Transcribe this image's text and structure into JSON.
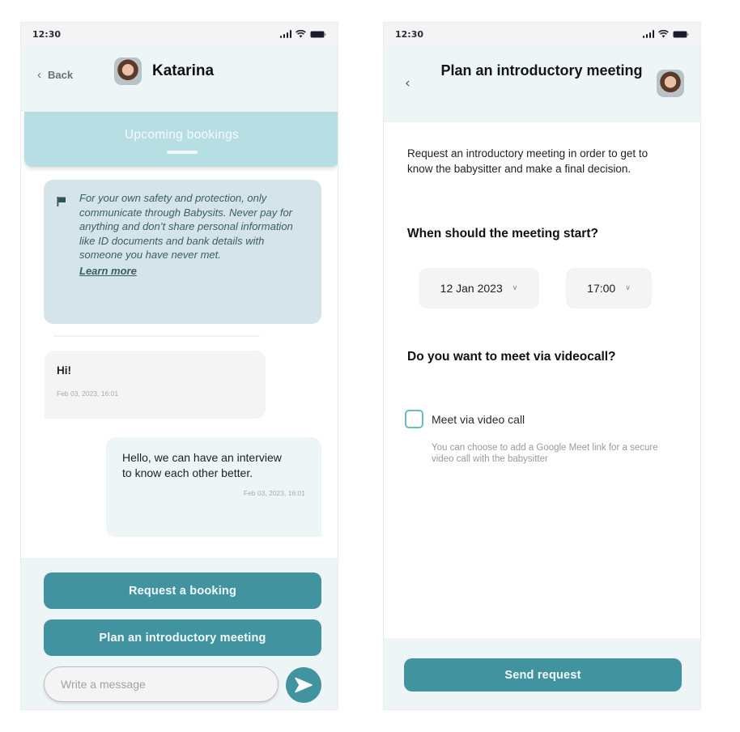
{
  "status_bar": {
    "time": "12:30",
    "icons": [
      "signal-icon",
      "wifi-icon",
      "battery-icon"
    ]
  },
  "chat_screen": {
    "header": {
      "back_label": "Back",
      "back_icon": "chevron-left-icon",
      "contact_name": "Katarina"
    },
    "bookings_bar": {
      "label": "Upcoming bookings"
    },
    "safety_notice": {
      "icon": "flag-icon",
      "text": "For your own safety and protection, only communicate through Babysits. Never pay for anything and don’t share personal information like ID documents and bank details with someone you have never met.",
      "link_label": "Learn more"
    },
    "messages": [
      {
        "direction": "incoming",
        "text": "Hi!",
        "timestamp": "Feb 03, 2023, 16:01"
      },
      {
        "direction": "outgoing",
        "text": "Hello, we can have an interview to know each other better.",
        "timestamp": "Feb 03, 2023, 16:01"
      }
    ],
    "actions": {
      "request_booking": "Request a booking",
      "plan_meeting": "Plan an introductory meeting"
    },
    "composer": {
      "placeholder": "Write a message",
      "value": "",
      "send_icon": "send-icon"
    }
  },
  "plan_screen": {
    "header": {
      "back_icon": "chevron-left-icon",
      "title": "Plan an introductory meeting"
    },
    "intro": "Request an introductory meeting in order to get to know the babysitter and make a final decision.",
    "start_question": "When should the meeting start?",
    "date_select": {
      "value": "12 Jan 2023"
    },
    "time_select": {
      "value": "17:00"
    },
    "video_question": "Do you want to meet via videocall?",
    "video_checkbox": {
      "label": "Meet via video call",
      "checked": false,
      "help": "You can choose to add a Google Meet link for a secure video call with the babysitter"
    },
    "submit_label": "Send request"
  },
  "colors": {
    "primary": "#4293a0",
    "header_bg": "#eef5f7",
    "bookings_bar": "#b7dee2",
    "notice_bg": "#d5e4e8",
    "notice_text": "#3b5e63",
    "checkbox_border": "#6cb8c4"
  }
}
